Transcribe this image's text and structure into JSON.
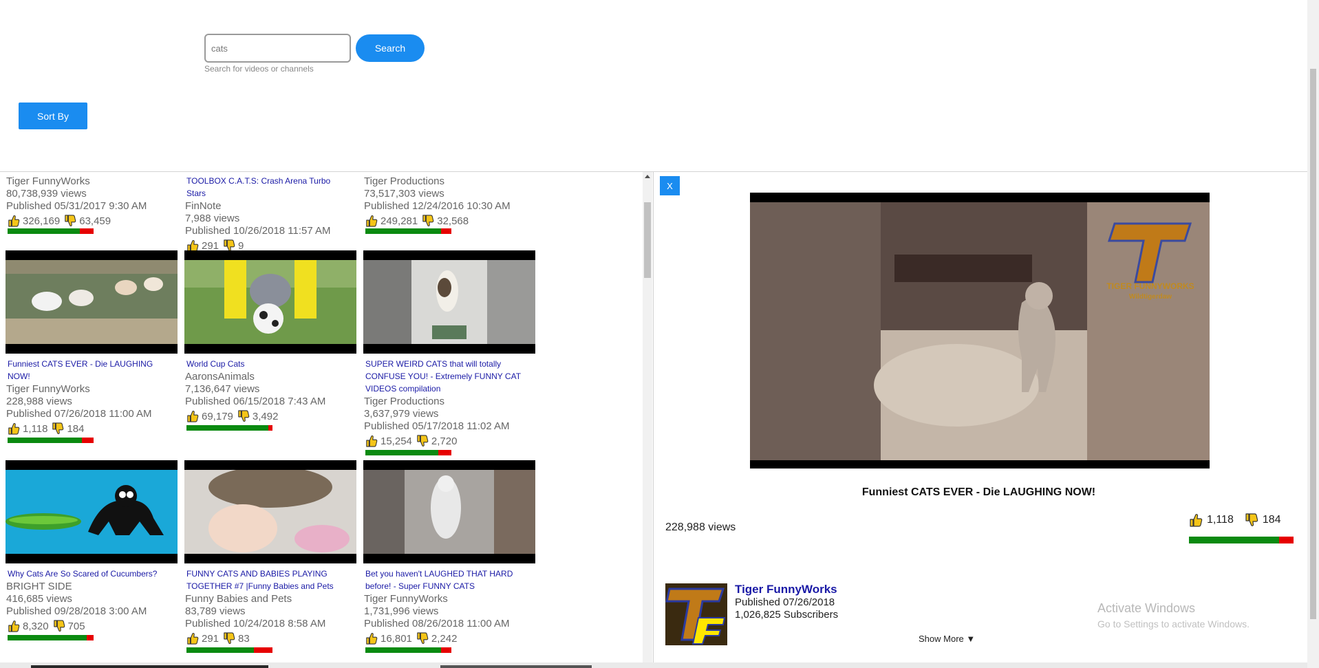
{
  "search": {
    "value": "cats",
    "button_label": "Search",
    "hint": "Search for videos or channels"
  },
  "sort": {
    "label": "Sort By"
  },
  "results": [
    {
      "title": "",
      "channel": "Tiger FunnyWorks",
      "views": "80,738,939 views",
      "published": "Published 05/31/2017 9:30 AM",
      "likes": "326,169",
      "dislikes": "63,459",
      "like_ratio": 0.84
    },
    {
      "title": "TOOLBOX C.A.T.S: Crash Arena Turbo Stars",
      "channel": "FinNote",
      "views": "7,988 views",
      "published": "Published 10/26/2018 11:57 AM",
      "likes": "291",
      "dislikes": "9",
      "like_ratio": 0.97
    },
    {
      "title": "",
      "channel": "Tiger Productions",
      "views": "73,517,303 views",
      "published": "Published 12/24/2016 10:30 AM",
      "likes": "249,281",
      "dislikes": "32,568",
      "like_ratio": 0.88
    },
    {
      "title": "Funniest CATS EVER - Die LAUGHING NOW!",
      "channel": "Tiger FunnyWorks",
      "views": "228,988 views",
      "published": "Published 07/26/2018 11:00 AM",
      "likes": "1,118",
      "dislikes": "184",
      "like_ratio": 0.86
    },
    {
      "title": "World Cup Cats",
      "channel": "AaronsAnimals",
      "views": "7,136,647 views",
      "published": "Published 06/15/2018 7:43 AM",
      "likes": "69,179",
      "dislikes": "3,492",
      "like_ratio": 0.95
    },
    {
      "title": "SUPER WEIRD CATS that will totally CONFUSE YOU! - Extremely FUNNY CAT VIDEOS compilation",
      "channel": "Tiger Productions",
      "views": "3,637,979 views",
      "published": "Published 05/17/2018 11:02 AM",
      "likes": "15,254",
      "dislikes": "2,720",
      "like_ratio": 0.85
    },
    {
      "title": "Why Cats Are So Scared of Cucumbers?",
      "channel": "BRIGHT SIDE",
      "views": "416,685 views",
      "published": "Published 09/28/2018 3:00 AM",
      "likes": "8,320",
      "dislikes": "705",
      "like_ratio": 0.92
    },
    {
      "title": "FUNNY CATS AND BABIES PLAYING TOGETHER #7 |Funny Babies and Pets",
      "channel": "Funny Babies and Pets",
      "views": "83,789 views",
      "published": "Published 10/24/2018 8:58 AM",
      "likes": "291",
      "dislikes": "83",
      "like_ratio": 0.78
    },
    {
      "title": "Bet you haven't LAUGHED THAT HARD before! - Super FUNNY CATS",
      "channel": "Tiger FunnyWorks",
      "views": "1,731,996 views",
      "published": "Published 08/26/2018 11:00 AM",
      "likes": "16,801",
      "dislikes": "2,242",
      "like_ratio": 0.88
    }
  ],
  "detail": {
    "close_label": "X",
    "title": "Funniest CATS EVER - Die LAUGHING NOW!",
    "views": "228,988 views",
    "likes": "1,118",
    "dislikes": "184",
    "like_ratio": 0.86,
    "channel_name": "Tiger FunnyWorks",
    "published": "Published 07/26/2018",
    "subscribers": "1,026,825 Subscribers",
    "show_more": "Show More ▼",
    "video_watermark_line1": "TIGER FUNNYWORKS",
    "video_watermark_line2": "Wildtigerdaw"
  },
  "os_watermark": {
    "line1": "Activate Windows",
    "line2": "Go to Settings to activate Windows."
  },
  "colors": {
    "accent": "#1a8cf0",
    "like_bar": "#0a8a10",
    "dislike_bar": "#e60000",
    "title_link": "#1a1aa6"
  },
  "icons": {
    "like": "thumbs-up-icon",
    "dislike": "thumbs-down-icon"
  }
}
